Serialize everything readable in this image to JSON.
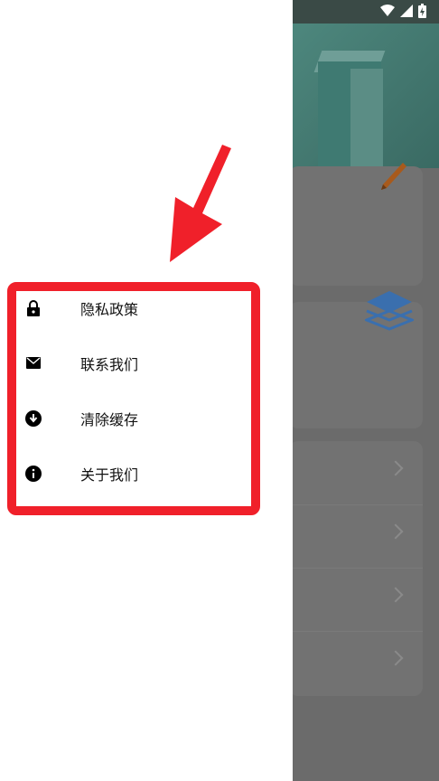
{
  "drawer": {
    "menu_items": [
      {
        "label": "隐私政策",
        "icon": "lock-icon"
      },
      {
        "label": "联系我们",
        "icon": "mail-icon"
      },
      {
        "label": "清除缓存",
        "icon": "download-circle-icon"
      },
      {
        "label": "关于我们",
        "icon": "info-circle-icon"
      }
    ]
  },
  "colors": {
    "highlight": "#f0202a",
    "drawer_bg": "#ffffff",
    "scrim": "#6b6b6b"
  }
}
